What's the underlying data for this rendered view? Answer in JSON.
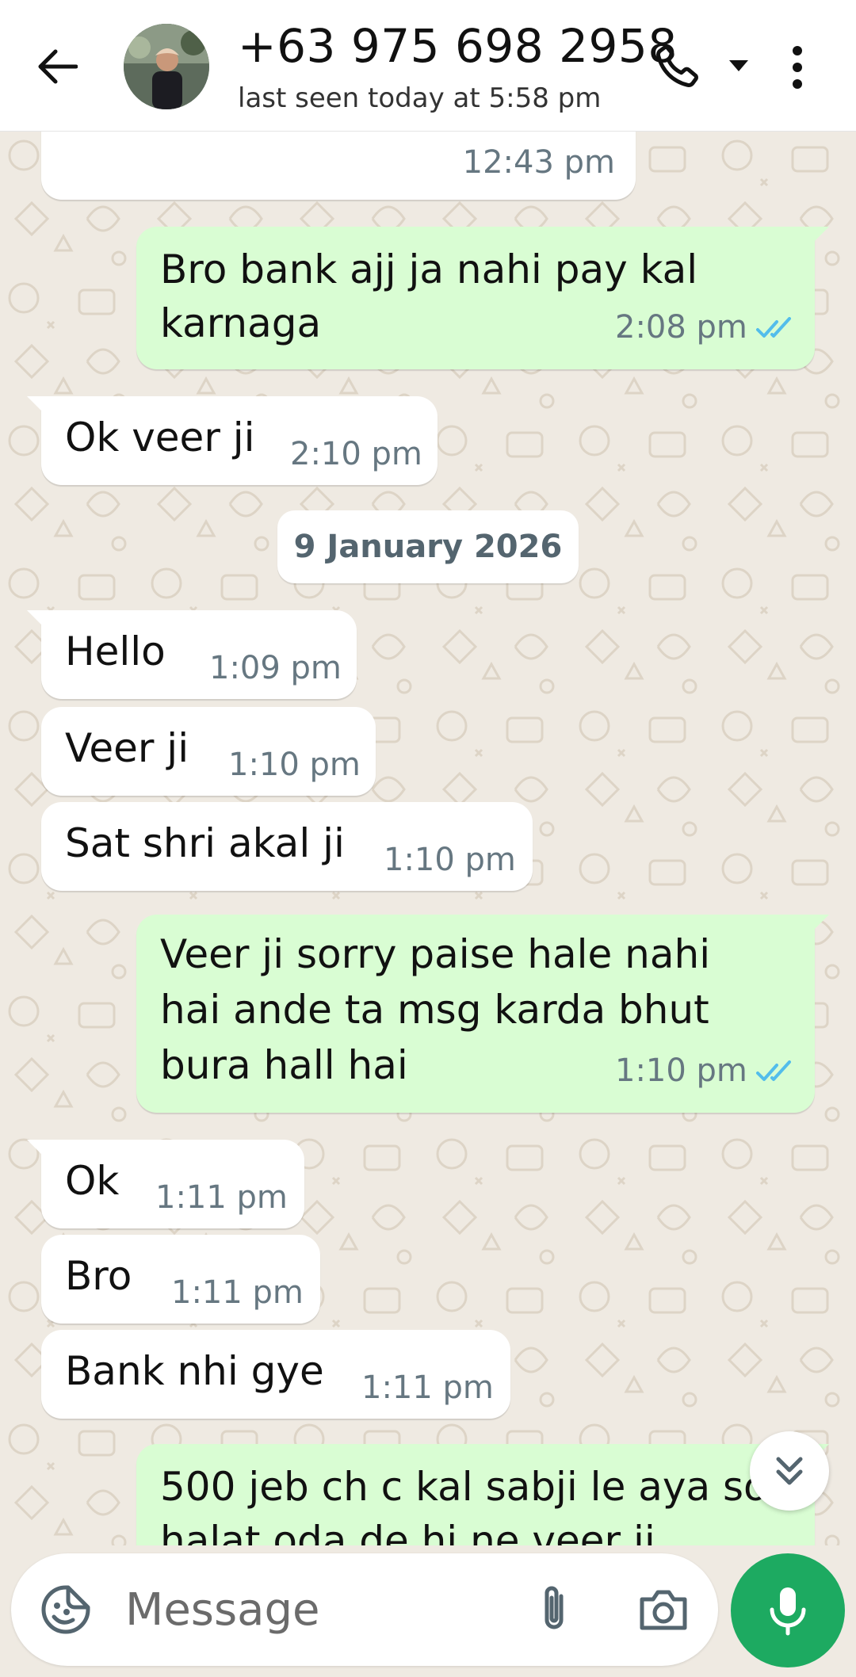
{
  "header": {
    "contact_name": "+63 975 698 2958",
    "status": "last seen today at 5:58 pm"
  },
  "date_separator": "9 January 2026",
  "messages": [
    {
      "dir": "in",
      "text": "",
      "time": "12:43 pm"
    },
    {
      "dir": "out",
      "lines": [
        "Bro bank ajj ja nahi pay kal",
        "karnaga"
      ],
      "time": "2:08 pm",
      "status": "read"
    },
    {
      "dir": "in",
      "text": "Ok veer ji",
      "time": "2:10 pm"
    },
    {
      "dir": "in",
      "text": "Hello",
      "time": "1:09 pm"
    },
    {
      "dir": "in",
      "text": "Veer ji",
      "time": "1:10 pm"
    },
    {
      "dir": "in",
      "text": "Sat shri akal ji",
      "time": "1:10 pm"
    },
    {
      "dir": "out",
      "lines": [
        "Veer ji sorry paise hale nahi",
        "hai ande ta msg karda bhut",
        "bura hall hai"
      ],
      "time": "1:10 pm",
      "status": "read"
    },
    {
      "dir": "in",
      "text": "Ok",
      "time": "1:11 pm"
    },
    {
      "dir": "in",
      "text": "Bro",
      "time": "1:11 pm"
    },
    {
      "dir": "in",
      "text": "Bank nhi gye",
      "time": "1:11 pm"
    },
    {
      "dir": "out",
      "lines": [
        "500 jeb ch c kal sabji le aya so",
        "halat oda de hi ne veer ji"
      ],
      "time": "",
      "status": "read"
    }
  ],
  "input": {
    "placeholder": "Message"
  },
  "colors": {
    "incoming_bubble": "#ffffff",
    "outgoing_bubble": "#d9fdd3",
    "read_ticks": "#53bdeb",
    "mic_button": "#1daa61",
    "wallpaper": "#efeae2"
  },
  "icons": [
    "back-arrow-icon",
    "avatar",
    "phone-icon",
    "caret-down-icon",
    "more-vert-icon",
    "chevron-double-down-icon",
    "sticker-icon",
    "paperclip-icon",
    "camera-icon",
    "mic-icon"
  ]
}
